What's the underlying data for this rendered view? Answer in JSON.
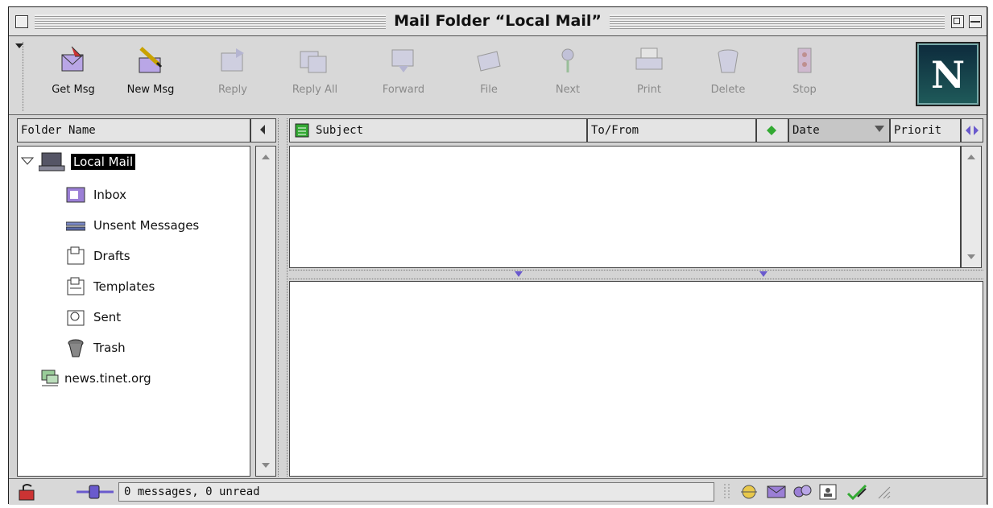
{
  "window": {
    "title": "Mail Folder “Local Mail”"
  },
  "toolbar": {
    "buttons": [
      {
        "label": "Get Msg",
        "enabled": true,
        "icon": "get-msg-icon"
      },
      {
        "label": "New Msg",
        "enabled": true,
        "icon": "new-msg-icon"
      },
      {
        "label": "Reply",
        "enabled": false,
        "icon": "reply-icon"
      },
      {
        "label": "Reply All",
        "enabled": false,
        "icon": "reply-all-icon"
      },
      {
        "label": "Forward",
        "enabled": false,
        "icon": "forward-icon"
      },
      {
        "label": "File",
        "enabled": false,
        "icon": "file-icon"
      },
      {
        "label": "Next",
        "enabled": false,
        "icon": "next-icon"
      },
      {
        "label": "Print",
        "enabled": false,
        "icon": "print-icon"
      },
      {
        "label": "Delete",
        "enabled": false,
        "icon": "delete-icon"
      },
      {
        "label": "Stop",
        "enabled": false,
        "icon": "stop-icon"
      }
    ],
    "logo": "N"
  },
  "folders": {
    "header": "Folder Name",
    "root": {
      "label": "Local Mail",
      "expanded": true,
      "selected": true
    },
    "children": [
      {
        "label": "Inbox",
        "icon": "inbox-icon"
      },
      {
        "label": "Unsent Messages",
        "icon": "unsent-icon"
      },
      {
        "label": "Drafts",
        "icon": "drafts-icon"
      },
      {
        "label": "Templates",
        "icon": "templates-icon"
      },
      {
        "label": "Sent",
        "icon": "sent-icon"
      },
      {
        "label": "Trash",
        "icon": "trash-icon"
      }
    ],
    "server": {
      "label": "news.tinet.org",
      "icon": "news-server-icon"
    }
  },
  "messages": {
    "columns": {
      "subject": "Subject",
      "to_from": "To/From",
      "date": "Date",
      "priority": "Priorit"
    },
    "sort_column": "Date",
    "rows": []
  },
  "status": {
    "text": "0 messages, 0 unread"
  },
  "colors": {
    "window_bg": "#d4d4d4",
    "selection": "#000000",
    "accent_green": "#2e8b2e",
    "icon_purple": "#7a5bb8"
  }
}
